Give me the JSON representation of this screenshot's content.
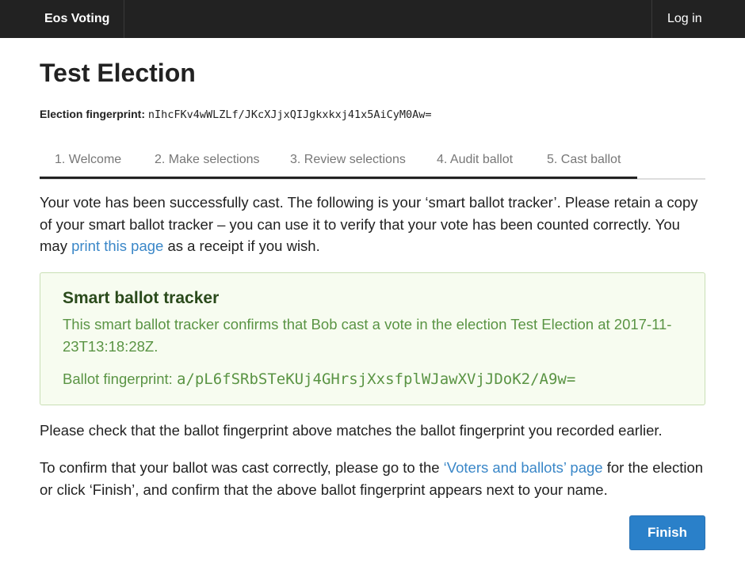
{
  "navbar": {
    "brand": "Eos Voting",
    "login": "Log in"
  },
  "page": {
    "title": "Test Election",
    "election_fingerprint_label": "Election fingerprint:",
    "election_fingerprint_value": "nIhcFKv4wWLZLf/JKcXJjxQIJgkxkxj41x5AiCyM0Aw="
  },
  "tabs": [
    {
      "label": "1. Welcome"
    },
    {
      "label": "2. Make selections"
    },
    {
      "label": "3. Review selections"
    },
    {
      "label": "4. Audit ballot"
    },
    {
      "label": "5. Cast ballot",
      "active": true
    }
  ],
  "intro": {
    "text_before_link": "Your vote has been successfully cast. The following is your ‘smart ballot tracker’. Please retain a copy of your smart ballot tracker – you can use it to verify that your vote has been counted correctly. You may ",
    "link": "print this page",
    "text_after_link": " as a receipt if you wish."
  },
  "tracker": {
    "title": "Smart ballot tracker",
    "text": "This smart ballot tracker confirms that Bob cast a vote in the election Test Election at 2017-11-23T13:18:28Z.",
    "fingerprint_label": "Ballot fingerprint: ",
    "fingerprint_value": "a/pL6fSRbSTeKUj4GHrsjXxsfplWJawXVjJDoK2/A9w="
  },
  "check_text": "Please check that the ballot fingerprint above matches the ballot fingerprint you recorded earlier.",
  "confirm": {
    "text_before_link": "To confirm that your ballot was cast correctly, please go to the ",
    "link": "‘Voters and ballots’ page",
    "text_after_link": " for the election or click ‘Finish’, and confirm that the above ballot fingerprint appears next to your name."
  },
  "buttons": {
    "finish": "Finish"
  }
}
